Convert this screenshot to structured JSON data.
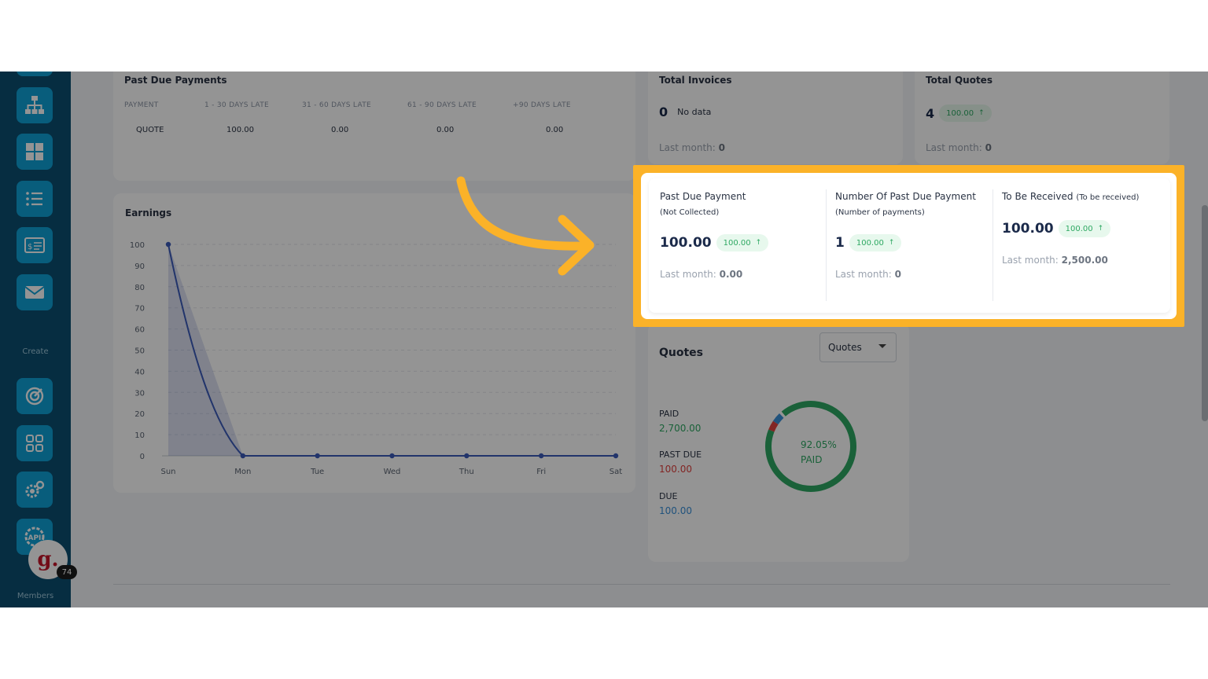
{
  "sidebar": {
    "create_label": "Create",
    "members_label": "Members",
    "avatar_letter": "g.",
    "badge_count": "74",
    "api_label": "API"
  },
  "past_due_payments": {
    "title": "Past Due Payments",
    "headers": [
      "PAYMENT",
      "1 - 30 DAYS LATE",
      "31 - 60 DAYS LATE",
      "61 - 90 DAYS LATE",
      "+90 DAYS LATE"
    ],
    "row": [
      "QUOTE",
      "100.00",
      "0.00",
      "0.00",
      "0.00"
    ]
  },
  "total_invoices": {
    "title": "Total Invoices",
    "value": "0",
    "note": "No data",
    "last_month": "Last month:",
    "last_month_value": "0"
  },
  "total_quotes": {
    "title": "Total Quotes",
    "value": "4",
    "pill": "100.00",
    "last_month": "Last month:",
    "last_month_value": "0"
  },
  "summary": {
    "past_due": {
      "title": "Past Due Payment",
      "sub": "(Not Collected)",
      "value": "100.00",
      "pill": "100.00",
      "last_month": "Last month:",
      "last_month_value": "0.00"
    },
    "number_past_due": {
      "title": "Number Of Past Due Payment",
      "sub": "(Number of payments)",
      "value": "1",
      "pill": "100.00",
      "last_month": "Last month:",
      "last_month_value": "0"
    },
    "to_be_received": {
      "title": "To Be Received",
      "title_small": "(To be received)",
      "value": "100.00",
      "pill": "100.00",
      "last_month": "Last month:",
      "last_month_value": "2,500.00"
    }
  },
  "earnings": {
    "title": "Earnings"
  },
  "chart_data": {
    "type": "area",
    "categories": [
      "Sun",
      "Mon",
      "Tue",
      "Wed",
      "Thu",
      "Fri",
      "Sat"
    ],
    "values": [
      100,
      0,
      0,
      0,
      0,
      0,
      0
    ],
    "yticks": [
      0,
      10,
      20,
      30,
      40,
      50,
      60,
      70,
      80,
      90,
      100
    ],
    "ylim": [
      0,
      100
    ],
    "grid": true,
    "color": "#3b5bb8"
  },
  "quotes": {
    "title": "Quotes",
    "select_value": "Quotes",
    "paid_label": "PAID",
    "paid_value": "2,700.00",
    "past_due_label": "PAST DUE",
    "past_due_value": "100.00",
    "due_label": "DUE",
    "due_value": "100.00",
    "donut_percent": "92.05%",
    "donut_label": "PAID",
    "donut_fractions": {
      "paid": 0.9205,
      "past_due": 0.0341,
      "due": 0.0341
    },
    "colors": {
      "paid": "#2ea862",
      "past_due": "#e0413e",
      "due": "#3a8fd8"
    }
  },
  "colors": {
    "highlight": "#fbb228",
    "accent": "#0fa0d6"
  }
}
